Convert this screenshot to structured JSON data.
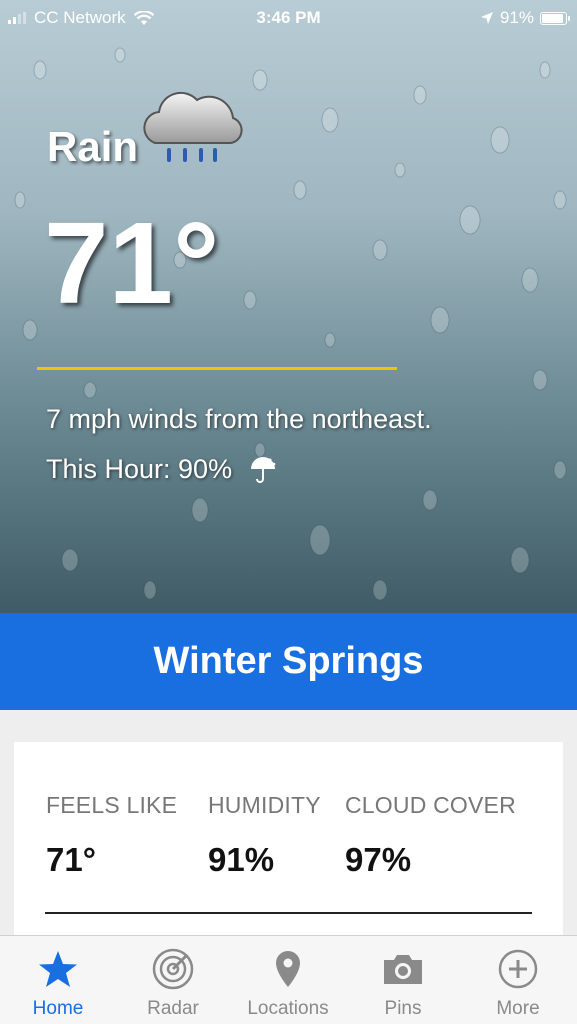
{
  "status_bar": {
    "carrier": "CC Network",
    "time": "3:46 PM",
    "battery_percent": "91%",
    "battery_level": 0.91
  },
  "weather": {
    "condition": "Rain",
    "condition_icon": "rain-cloud-icon",
    "temperature": "71°",
    "wind": "7 mph winds from the northeast.",
    "precip": "This Hour: 90%",
    "precip_icon": "umbrella-icon"
  },
  "location": {
    "name": "Winter Springs"
  },
  "details": {
    "stats": [
      {
        "label": "FEELS LIKE",
        "value": "71°"
      },
      {
        "label": "HUMIDITY",
        "value": "91%"
      },
      {
        "label": "CLOUD COVER",
        "value": "97%"
      }
    ]
  },
  "tabs": [
    {
      "label": "Home",
      "icon": "star-icon",
      "active": true
    },
    {
      "label": "Radar",
      "icon": "radar-icon",
      "active": false
    },
    {
      "label": "Locations",
      "icon": "location-pin-icon",
      "active": false
    },
    {
      "label": "Pins",
      "icon": "camera-icon",
      "active": false
    },
    {
      "label": "More",
      "icon": "plus-circle-icon",
      "active": false
    }
  ],
  "colors": {
    "accent_blue": "#1a6fe0",
    "divider_yellow": "#f0c400",
    "inactive_tab": "#8a8a8a"
  }
}
